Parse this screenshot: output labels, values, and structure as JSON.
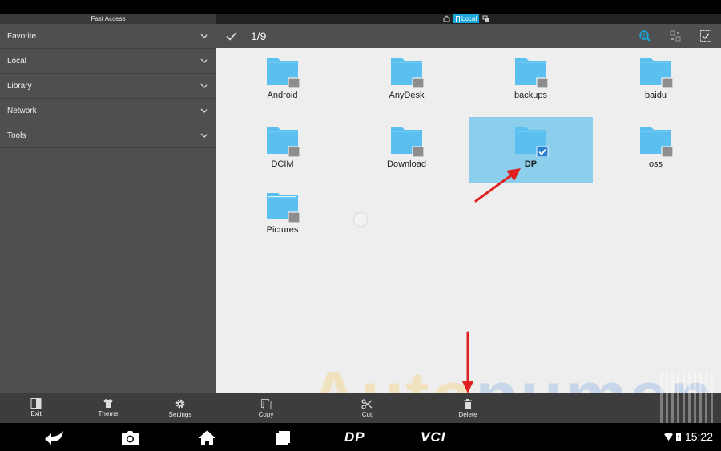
{
  "left_panel": {
    "title": "Fast Access",
    "items": [
      {
        "label": "Favorite"
      },
      {
        "label": "Local"
      },
      {
        "label": "Library"
      },
      {
        "label": "Network"
      },
      {
        "label": "Tools"
      }
    ],
    "bottom_actions": [
      {
        "label": "Exit",
        "icon": "exit-icon"
      },
      {
        "label": "Theme",
        "icon": "theme-shirt-icon"
      },
      {
        "label": "Settings",
        "icon": "gear-icon"
      }
    ]
  },
  "header": {
    "location_tabs": [
      {
        "label": "",
        "icon": "home-icon"
      },
      {
        "label": "Local",
        "icon": "phone-icon",
        "active": true
      },
      {
        "label": "",
        "icon": "device-icon"
      }
    ]
  },
  "toolbar": {
    "selection_count": "1/9",
    "icons": [
      "check-icon",
      "search-globe-icon",
      "switch-view-icon",
      "select-all-icon"
    ]
  },
  "files": [
    {
      "name": "Android",
      "selected": false
    },
    {
      "name": "AnyDesk",
      "selected": false
    },
    {
      "name": "backups",
      "selected": false
    },
    {
      "name": "baidu",
      "selected": false
    },
    {
      "name": "DCIM",
      "selected": false
    },
    {
      "name": "Download",
      "selected": false
    },
    {
      "name": "DP",
      "selected": true
    },
    {
      "name": "oss",
      "selected": false
    },
    {
      "name": "Pictures",
      "selected": false
    }
  ],
  "bottom_actions": [
    {
      "label": "Copy",
      "icon": "copy-icon"
    },
    {
      "label": "Cut",
      "icon": "scissors-icon"
    },
    {
      "label": "Delete",
      "icon": "trash-icon"
    }
  ],
  "watermark": {
    "part1": "Auto",
    "part2": "numen"
  },
  "navbar": {
    "dp_label": "DP",
    "vci_label": "VCI",
    "clock": "15:22"
  },
  "colors": {
    "accent": "#1aa6d9",
    "folder": "#5bc0ef",
    "selection": "#8ccfec",
    "annotation": "#e02020"
  }
}
